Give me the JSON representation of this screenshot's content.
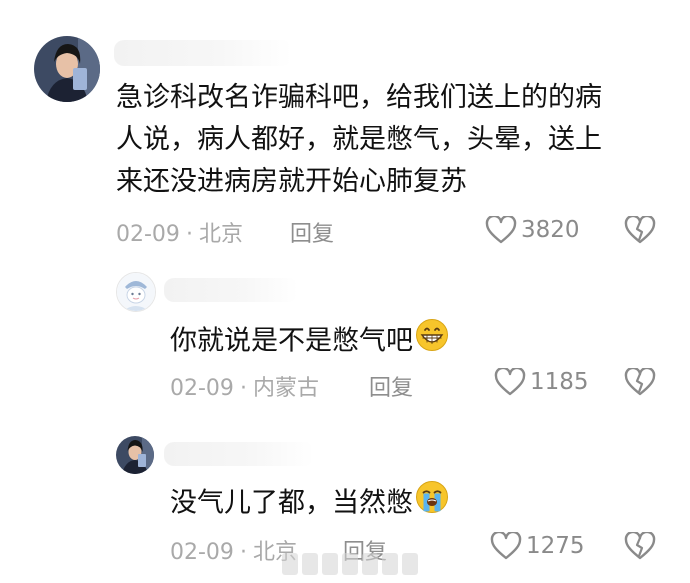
{
  "comments": [
    {
      "text_lines": [
        "急诊科改名诈骗科吧，给我们送上的的病",
        "人说，病人都好，就是憋气，头晕，送上",
        "来还没进病房就开始心肺复苏"
      ],
      "date": "02-09",
      "location": "北京",
      "reply_label": "回复",
      "likes": "3820"
    },
    {
      "text": "你就说是不是憋气吧",
      "emoji": "grinning-face",
      "date": "02-09",
      "location": "内蒙古",
      "reply_label": "回复",
      "likes": "1185"
    },
    {
      "text": "没气儿了都，当然憋",
      "emoji": "loudly-crying-face",
      "date": "02-09",
      "location": "北京",
      "reply_label": "回复",
      "likes": "1275"
    }
  ],
  "meta_separator": "·",
  "colors": {
    "text": "#111111",
    "meta": "#a9a9a9",
    "icon": "#8a8a8a",
    "emoji_yellow": "#f7c52b"
  }
}
